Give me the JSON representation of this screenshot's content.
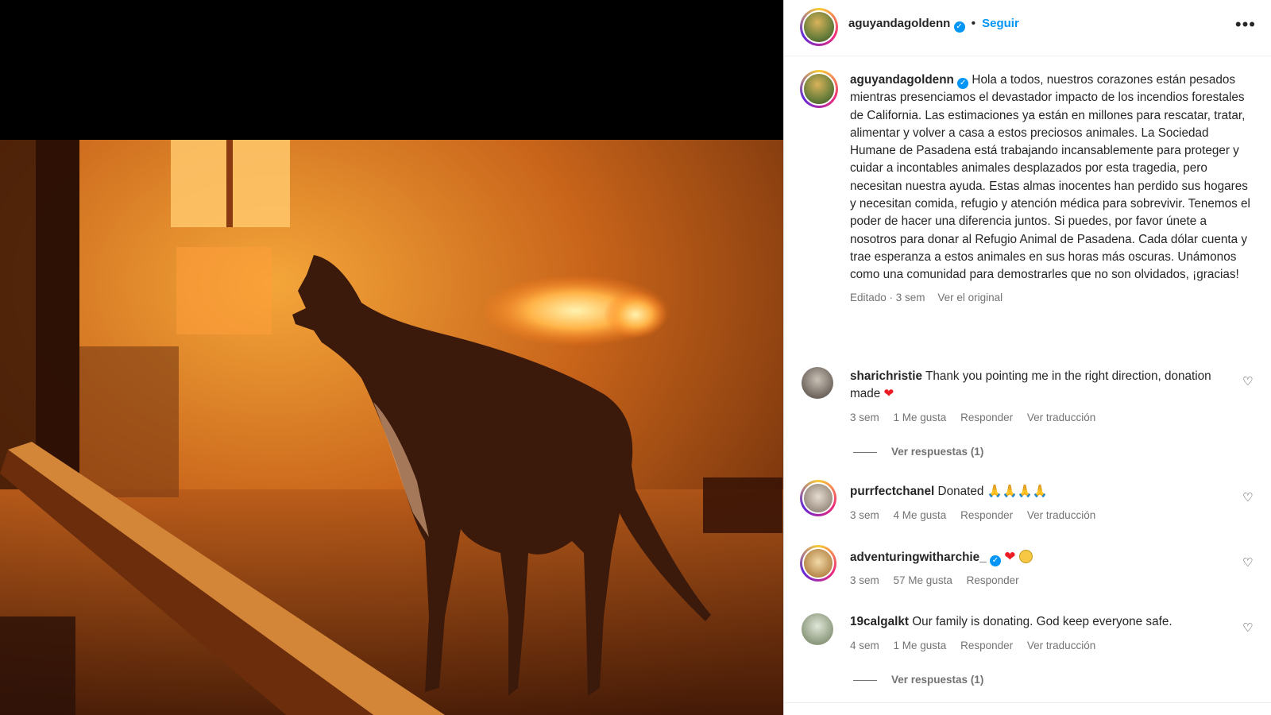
{
  "post": {
    "username": "aguyandagoldenn",
    "follow_label": "Seguir",
    "more_label": "•••",
    "dot": "•",
    "caption": "Hola a todos, nuestros corazones están pesados mientras presenciamos el devastador impacto de los incendios forestales de California. Las estimaciones ya están en millones para rescatar, tratar, alimentar y volver a casa a estos preciosos animales. La Sociedad Humane de Pasadena está trabajando incansablemente para proteger y cuidar a incontables animales desplazados por esta tragedia, pero necesitan nuestra ayuda. Estas almas inocentes han perdido sus hogares y necesitan comida, refugio y atención médica para sobrevivir. Tenemos el poder de hacer una diferencia juntos. Si puedes, por favor únete a nosotros para donar al Refugio Animal de Pasadena. Cada dólar cuenta y trae esperanza a estos animales en sus horas más oscuras. Unámonos como una comunidad para demostrarles que no son olvidados, ¡gracias!",
    "edited_label": "Editado · 3 sem",
    "see_original": "Ver el original"
  },
  "comments": [
    {
      "username": "sharichristie",
      "text": "Thank you pointing me in the right direction, donation made",
      "emoji": "❤",
      "time": "3 sem",
      "likes": "1 Me gusta",
      "reply": "Responder",
      "translate": "Ver traducción",
      "replies": "Ver respuestas (1)"
    },
    {
      "username": "purrfectchanel",
      "text": "Donated 🙏🙏🙏🙏",
      "time": "3 sem",
      "likes": "4 Me gusta",
      "reply": "Responder",
      "translate": "Ver traducción"
    },
    {
      "username": "adventuringwitharchie_",
      "emoji": "❤",
      "time": "3 sem",
      "likes": "57 Me gusta",
      "reply": "Responder"
    },
    {
      "username": "19calgalkt",
      "text": "Our family is donating. God keep everyone safe.",
      "time": "4 sem",
      "likes": "1 Me gusta",
      "reply": "Responder",
      "translate": "Ver traducción",
      "replies": "Ver respuestas (1)"
    }
  ],
  "icons": {
    "heart_outline": "♡",
    "verified": "✓"
  },
  "colors": {
    "link_blue": "#0095f6",
    "muted": "#737373",
    "fire_orange": "#e87a1c"
  }
}
